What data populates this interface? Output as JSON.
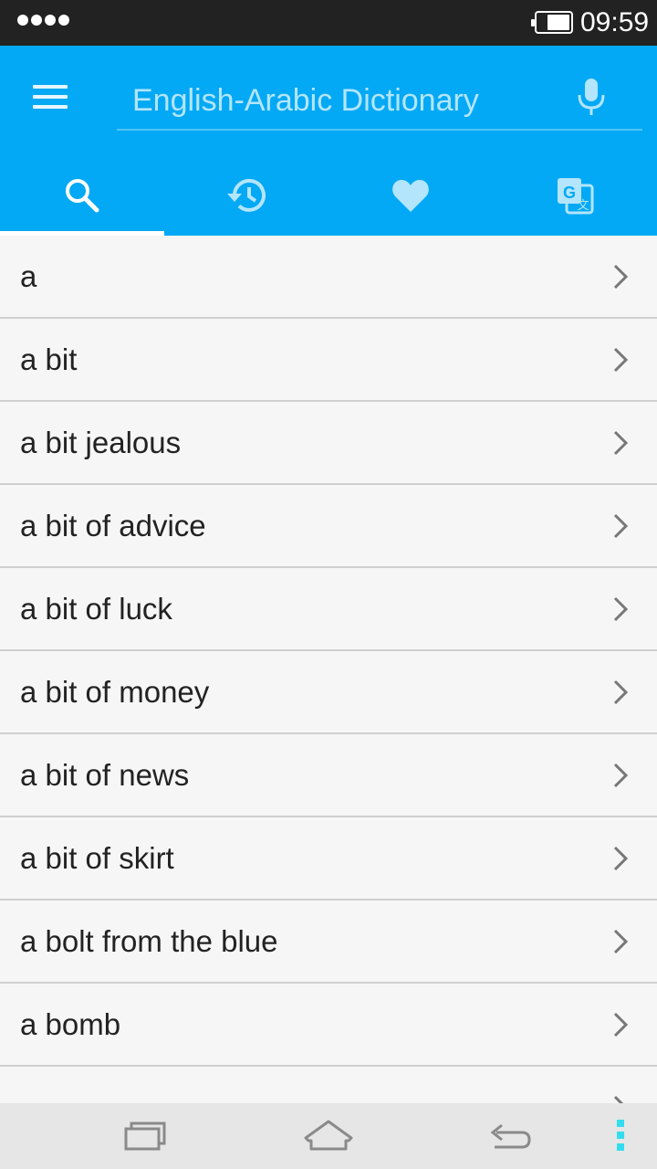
{
  "status_bar": {
    "time": "09:59",
    "icons": [
      "signal-dots-icon",
      "battery-icon"
    ]
  },
  "app_bar": {
    "search_placeholder": "English-Arabic Dictionary",
    "icons": [
      "menu-icon",
      "mic-icon"
    ],
    "background_color": "#03a9f4"
  },
  "tabs": [
    {
      "icon": "search-icon",
      "active": true
    },
    {
      "icon": "history-icon",
      "active": false
    },
    {
      "icon": "heart-icon",
      "active": false
    },
    {
      "icon": "translate-icon",
      "active": false
    }
  ],
  "word_list": [
    "a",
    "a bit",
    "a bit jealous",
    "a bit of advice",
    "a bit of luck",
    "a bit of money",
    "a bit of news",
    "a bit of skirt",
    "a bolt from the blue",
    "a bomb"
  ],
  "nav_bar": {
    "icons": [
      "recent-apps-icon",
      "home-icon",
      "back-icon",
      "more-dots-icon"
    ],
    "accent_color": "#33ddf0"
  }
}
